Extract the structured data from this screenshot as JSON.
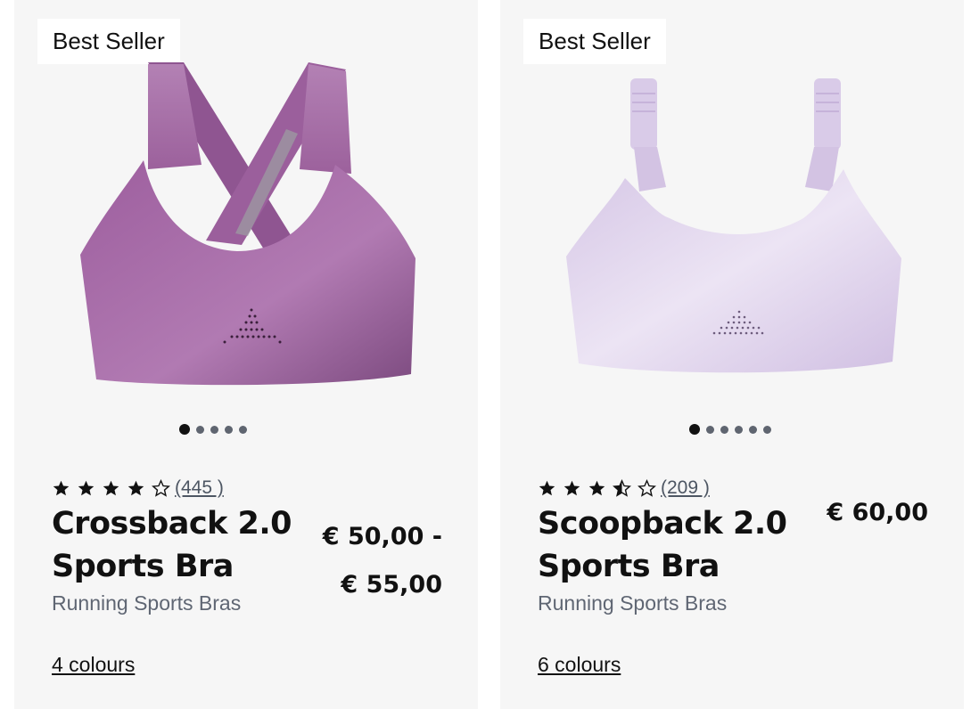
{
  "products": [
    {
      "badge": "Best Seller",
      "rating": 4,
      "reviews": "(445 )",
      "name": "Crossback 2.0 Sports Bra",
      "price_line1": "€ 50,00 -",
      "price_line2": "€ 55,00",
      "category": "Running Sports Bras",
      "colours": "4 colours",
      "color": "#a56aa6",
      "image_dots": 5
    },
    {
      "badge": "Best Seller",
      "rating": 3.5,
      "reviews": "(209 )",
      "name": "Scoopback 2.0 Sports Bra",
      "price": "€ 60,00",
      "category": "Running Sports Bras",
      "colours": "6 colours",
      "color": "#ddd0ec",
      "image_dots": 6
    }
  ]
}
